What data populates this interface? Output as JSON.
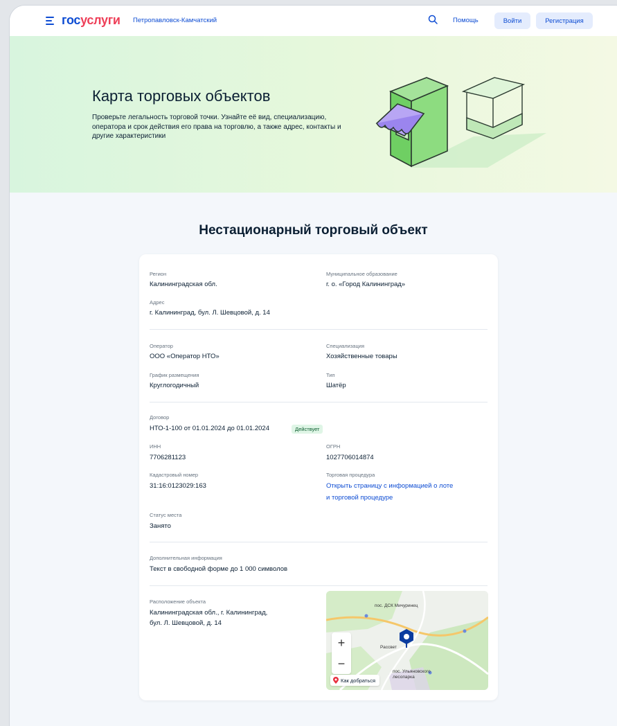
{
  "header": {
    "logo_part1": "гос",
    "logo_part2": "услуги",
    "city": "Петропавловск-Камчатский",
    "help": "Помощь",
    "login": "Войти",
    "register": "Регистрация"
  },
  "hero": {
    "title": "Карта торговых объектов",
    "description": "Проверьте легальность торговой точки. Узнайте её вид, специализацию, оператора и срок действия его права на торговлю, а также адрес, контакты и другие характеристики"
  },
  "page_title": "Нестационарный торговый объект",
  "fields": {
    "region": {
      "label": "Регион",
      "value": "Калининградская обл."
    },
    "municipality": {
      "label": "Муниципальное образование",
      "value": "г. о. «Город Калининград»"
    },
    "address": {
      "label": "Адрес",
      "value": "г. Калининград, бул. Л. Шевцовой, д. 14"
    },
    "operator": {
      "label": "Оператор",
      "value": "ООО «Оператор НТО»"
    },
    "specialization": {
      "label": "Специализация",
      "value": "Хозяйственные товары"
    },
    "schedule": {
      "label": "График размещения",
      "value": "Круглогодичный"
    },
    "type": {
      "label": "Тип",
      "value": "Шатёр"
    },
    "contract": {
      "label": "Договор",
      "value": "НТО-1-100 от 01.01.2024 до 01.01.2024",
      "status": "Действует"
    },
    "inn": {
      "label": "ИНН",
      "value": "7706281123"
    },
    "ogrn": {
      "label": "ОГРН",
      "value": "1027706014874"
    },
    "cadastral": {
      "label": "Кадастровый номер",
      "value": "31:16:0123029:163"
    },
    "procedure": {
      "label": "Торговая процедура",
      "link_line1": "Открыть страницу с информацией о лоте",
      "link_line2": "и торговой процедуре"
    },
    "place_status": {
      "label": "Статус места",
      "value": "Занято"
    },
    "extra_info": {
      "label": "Дополнительная информация",
      "value": "Текст в свободной форме до 1 000 символов"
    },
    "location": {
      "label": "Расположение объекта",
      "value_line1": "Калининградская обл., г. Калининград,",
      "value_line2": "бул. Л. Шевцовой, д. 14"
    }
  },
  "map": {
    "zoom_in": "+",
    "zoom_out": "−",
    "route": "Как добраться",
    "labels": [
      "пос. ДСК Мичуринец",
      "Рассвет",
      "пос. Ульяновского лесопарка"
    ]
  },
  "colors": {
    "brand_blue": "#0d4cd3",
    "brand_red": "#ee3f58",
    "status_green_bg": "#dff5e6"
  }
}
